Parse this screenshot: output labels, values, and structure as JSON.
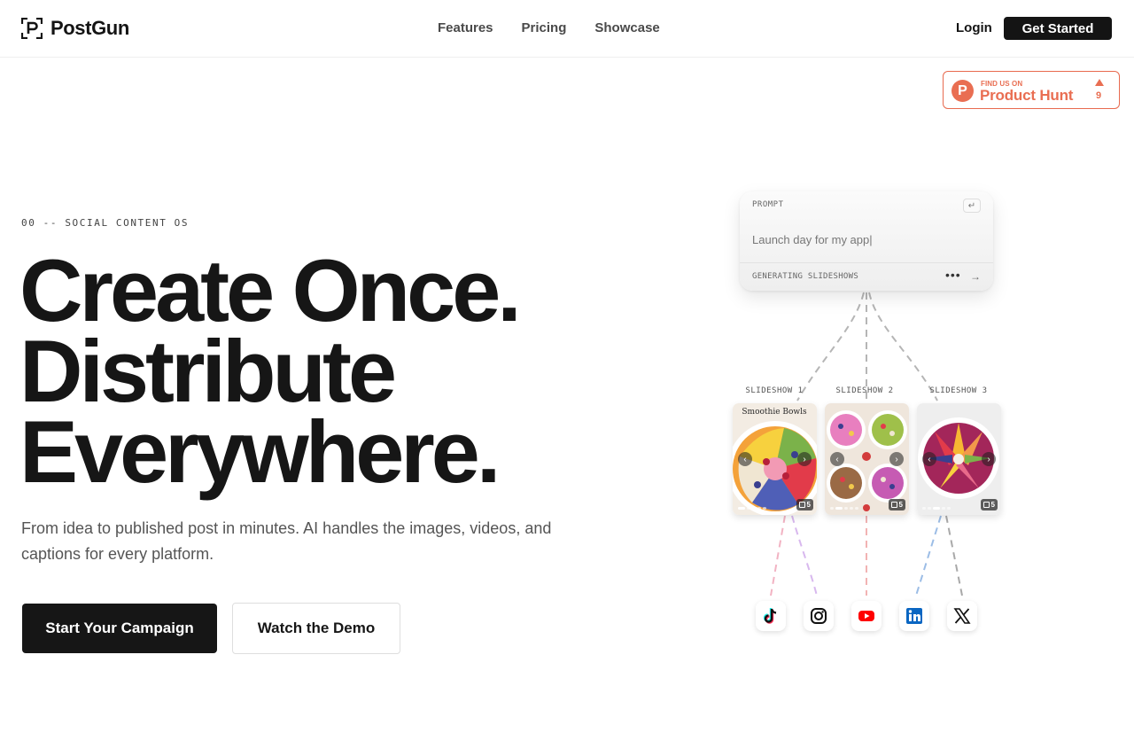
{
  "header": {
    "brand_name": "PostGun",
    "nav": [
      "Features",
      "Pricing",
      "Showcase"
    ],
    "login_label": "Login",
    "cta_label": "Get Started"
  },
  "product_hunt": {
    "small_text": "FIND US ON",
    "big_text": "Product Hunt",
    "logo_letter": "P",
    "upvotes": "9"
  },
  "hero": {
    "eyebrow": "00 -- SOCIAL CONTENT OS",
    "headline": [
      "Create Once.",
      "Distribute",
      "Everywhere."
    ],
    "subtext": "From idea to published post in minutes. AI handles the images, videos, and captions for every platform.",
    "primary_cta": "Start Your Campaign",
    "secondary_cta": "Watch the Demo"
  },
  "prompt_card": {
    "label": "PROMPT",
    "input_value": "Launch day for my app|",
    "status": "GENERATING SLIDESHOWS",
    "enter_glyph": "↵",
    "dots_glyph": "•••",
    "arrow_glyph": "→"
  },
  "slideshows": [
    {
      "label": "SLIDESHOW 1",
      "caption": "Smoothie Bowls",
      "count": "5"
    },
    {
      "label": "SLIDESHOW 2",
      "count": "5"
    },
    {
      "label": "SLIDESHOW 3",
      "count": "5"
    }
  ],
  "slide_nav": {
    "prev": "‹",
    "next": "›"
  },
  "platforms": [
    "tiktok-icon",
    "instagram-icon",
    "youtube-icon",
    "linkedin-icon",
    "x-icon"
  ],
  "colors": {
    "ink": "#141414",
    "product_hunt": "#e96e52",
    "youtube": "#ff0000",
    "linkedin": "#0a66c2"
  }
}
